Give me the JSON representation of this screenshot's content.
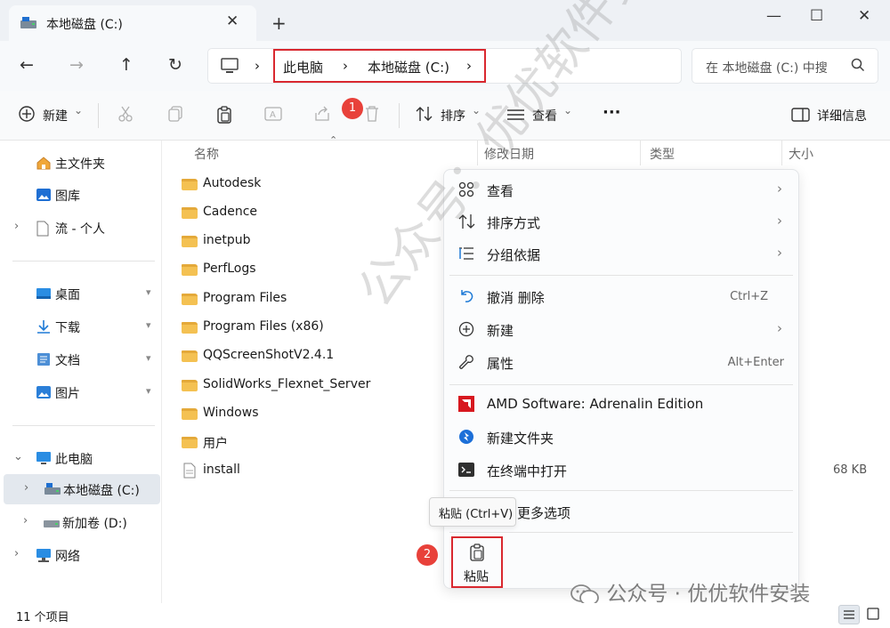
{
  "window": {
    "tab_title": "本地磁盘 (C:)",
    "close_glyph": "✕",
    "newtab_glyph": "+",
    "minimize_glyph": "—",
    "maximize_glyph": "☐",
    "winclose_glyph": "✕"
  },
  "nav": {
    "back": "←",
    "forward": "→",
    "up": "↑",
    "refresh": "↻",
    "breadcrumbs": [
      "此电脑",
      "本地磁盘 (C:)"
    ],
    "sep": "›",
    "search_placeholder": "在 本地磁盘 (C:) 中搜"
  },
  "toolbar": {
    "new_label": "新建",
    "sort_label": "排序",
    "view_label": "查看",
    "more_label": "···",
    "details_label": "详细信息",
    "badge1": "1",
    "caret": "⌄"
  },
  "sidebar": {
    "items": [
      {
        "label": "主文件夹",
        "icon": "home-icon"
      },
      {
        "label": "图库",
        "icon": "gallery-icon"
      },
      {
        "label": "流 - 个人",
        "icon": "cloud-icon"
      },
      {
        "label": "桌面",
        "icon": "desktop-icon"
      },
      {
        "label": "下载",
        "icon": "download-icon"
      },
      {
        "label": "文档",
        "icon": "document-icon"
      },
      {
        "label": "图片",
        "icon": "pictures-icon"
      },
      {
        "label": "此电脑",
        "icon": "computer-icon"
      },
      {
        "label": "本地磁盘 (C:)",
        "icon": "drive-icon"
      },
      {
        "label": "新加卷 (D:)",
        "icon": "drive-icon"
      },
      {
        "label": "网络",
        "icon": "network-icon"
      }
    ],
    "pin_glyph": "📌",
    "chev_right": "›",
    "chev_down": "⌄"
  },
  "columns": {
    "name": "名称",
    "modified": "修改日期",
    "type": "类型",
    "size": "大小"
  },
  "files": [
    {
      "name": "Autodesk"
    },
    {
      "name": "Cadence"
    },
    {
      "name": "inetpub"
    },
    {
      "name": "PerfLogs"
    },
    {
      "name": "Program Files"
    },
    {
      "name": "Program Files (x86)"
    },
    {
      "name": "QQScreenShotV2.4.1"
    },
    {
      "name": "SolidWorks_Flexnet_Server"
    },
    {
      "name": "Windows"
    },
    {
      "name": "用户"
    },
    {
      "name": "install",
      "size": "68 KB"
    }
  ],
  "context_menu": {
    "view": "查看",
    "sort": "排序方式",
    "group": "分组依据",
    "undo": "撤消 删除",
    "undo_shortcut": "Ctrl+Z",
    "new": "新建",
    "properties": "属性",
    "properties_shortcut": "Alt+Enter",
    "amd": "AMD Software: Adrenalin Edition",
    "new_folder": "新建文件夹",
    "terminal": "在终端中打开",
    "more_options": "更多选项",
    "arrow": "›",
    "paste_tooltip": "粘贴 (Ctrl+V)",
    "paste_label": "粘贴",
    "badge2": "2"
  },
  "status": {
    "count": "11 个项目"
  },
  "watermarks": {
    "diagonal": "公众号：优优软件安装",
    "bottom": "公众号 · 优优软件安装"
  },
  "colors": {
    "accent": "#0067c0",
    "highlight": "#d9282f",
    "badge": "#e8413a",
    "folder": "#f4c152"
  }
}
